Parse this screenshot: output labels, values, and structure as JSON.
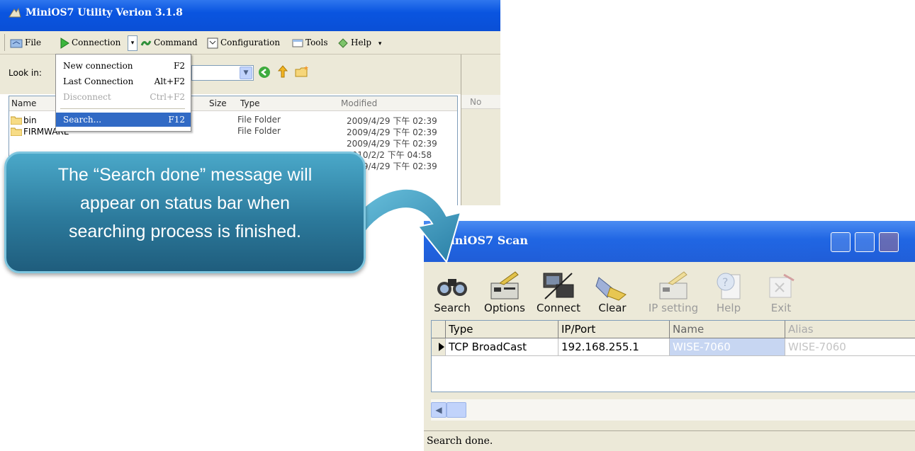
{
  "utility_window": {
    "title": "MiniOS7 Utility Verion 3.1.8",
    "toolbar": [
      {
        "label": "File",
        "icon": "file-icon"
      },
      {
        "label": "Connection",
        "icon": "play-icon"
      },
      {
        "label": "Command",
        "icon": "command-icon"
      },
      {
        "label": "Configuration",
        "icon": "configuration-icon"
      },
      {
        "label": "Tools",
        "icon": "tools-icon"
      },
      {
        "label": "Help",
        "icon": "help-icon"
      }
    ],
    "look_in_label": "Look in:",
    "file_columns": [
      "Name",
      "Size",
      "Type",
      "Modified"
    ],
    "right_pane_column": "No",
    "files": [
      {
        "name": "bin",
        "type": "File Folder",
        "modified": "2009/4/29 下午 02:39"
      },
      {
        "name": "FIRMWARE",
        "type": "File Folder",
        "modified": "2009/4/29 下午 02:39"
      },
      {
        "name": "",
        "type": "",
        "modified": "2009/4/29 下午 02:39"
      },
      {
        "name": "",
        "type": "",
        "modified": "2010/2/2 下午 04:58"
      },
      {
        "name": "",
        "type": "",
        "modified": "2009/4/29 下午 02:39"
      }
    ],
    "connection_menu": [
      {
        "label": "New connection",
        "shortcut": "F2",
        "state": "normal"
      },
      {
        "label": "Last Connection",
        "shortcut": "Alt+F2",
        "state": "normal"
      },
      {
        "label": "Disconnect",
        "shortcut": "Ctrl+F2",
        "state": "disabled"
      },
      {
        "label": "Search...",
        "shortcut": "F12",
        "state": "highlighted"
      }
    ]
  },
  "callout": {
    "lines": [
      "The “Search done” message will",
      "appear on status bar when",
      "searching process is finished."
    ],
    "colors": {
      "fill": "#2c7a9c",
      "border": "#7fc6df",
      "arrow": "#3a97bd"
    }
  },
  "scan_window": {
    "title": "MiniOS7 Scan",
    "toolbar": [
      {
        "label": "Search",
        "icon": "binoculars-icon",
        "enabled": true
      },
      {
        "label": "Options",
        "icon": "options-icon",
        "enabled": true
      },
      {
        "label": "Connect",
        "icon": "connect-icon",
        "enabled": true
      },
      {
        "label": "Clear",
        "icon": "broom-icon",
        "enabled": true
      },
      {
        "label": "IP setting",
        "icon": "ip-setting-icon",
        "enabled": false
      },
      {
        "label": "Help",
        "icon": "help-doc-icon",
        "enabled": false
      },
      {
        "label": "Exit",
        "icon": "exit-icon",
        "enabled": false
      }
    ],
    "grid_columns": [
      "Type",
      "IP/Port",
      "Name",
      "Alias"
    ],
    "rows": [
      {
        "type": "TCP BroadCast",
        "ip_port": "192.168.255.1",
        "name": "WISE-7060",
        "alias": "WISE-7060"
      }
    ],
    "status": "Search done."
  }
}
